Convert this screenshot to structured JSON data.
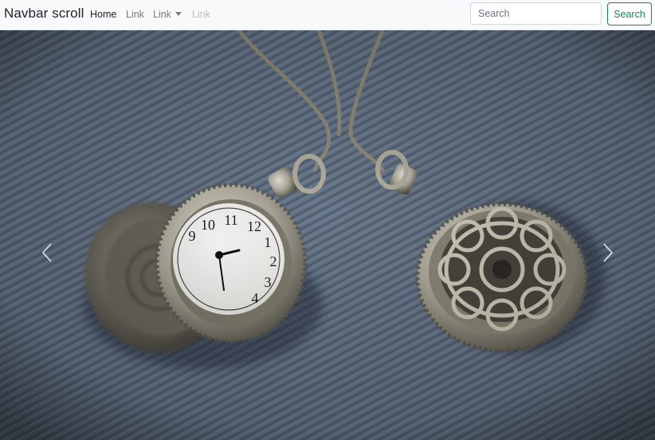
{
  "navbar": {
    "brand": "Navbar scroll",
    "links": [
      {
        "label": "Home",
        "state": "active"
      },
      {
        "label": "Link",
        "state": "normal"
      },
      {
        "label": "Link",
        "state": "dropdown"
      },
      {
        "label": "Link",
        "state": "disabled"
      }
    ],
    "search": {
      "placeholder": "Search",
      "button_label": "Search",
      "button_color": "#198754"
    }
  },
  "carousel": {
    "image": "pocket-watches-on-denim",
    "prev_icon": "chevron-left-icon",
    "next_icon": "chevron-right-icon",
    "clock_numbers": [
      "10",
      "11",
      "12",
      "1",
      "2",
      "3",
      "4",
      "9"
    ]
  }
}
